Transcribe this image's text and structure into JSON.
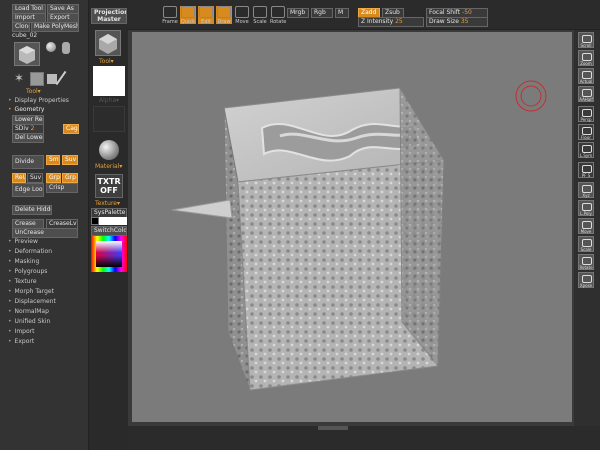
{
  "app": {
    "tool_buttons": [
      "Load Tool",
      "Save As",
      "Import",
      "Export",
      "Clone",
      "Make PolyMesh3D"
    ],
    "tool_name": "cube_02",
    "tool_label": "Tool▾",
    "sub_tools_label": "Geometry"
  },
  "left_panel": {
    "menu_top": [
      "Display Properties",
      "Geometry"
    ],
    "lower_res": "Lower Res",
    "sdiv": "SDiv",
    "sdiv_value": "2",
    "cage": "Cage",
    "del_lower": "Del Lower",
    "divide": "Divide",
    "smt": "Smt",
    "suv": "Suv",
    "reuv": "ReUV",
    "edge_loop": "Edge Loop",
    "grp_label": "Grp",
    "crisp": "Crisp",
    "delete_hidden": "Delete Hidden",
    "crease": "Crease",
    "crease_lvl": "CreaseLvl",
    "uncrease": "UnCrease",
    "menu_bottom": [
      "Preview",
      "Deformation",
      "Masking",
      "Polygroups",
      "Texture",
      "Morph Target",
      "Displacement",
      "NormalMap",
      "Unified Skin",
      "Import",
      "Export"
    ]
  },
  "middle_palette": {
    "projection_master": "Projection Master",
    "tool_label": "Tool▾",
    "alpha_label": "Alpha▾",
    "material_label": "Material▾",
    "txtr_off_line1": "TXTR",
    "txtr_off_line2": "OFF",
    "texture_label": "Texture▾",
    "syspalette": "SysPalette",
    "switchcolor": "SwitchColor"
  },
  "toolbar": {
    "buttons": [
      {
        "label": "Frame",
        "active": false
      },
      {
        "label": "Quick",
        "active": true
      },
      {
        "label": "Edit",
        "active": true
      },
      {
        "label": "Draw",
        "active": true
      },
      {
        "label": "Move",
        "active": false
      },
      {
        "label": "Scale",
        "active": false
      },
      {
        "label": "Rotate",
        "active": false
      }
    ],
    "mrgb": "Mrgb",
    "rgb": "Rgb",
    "m": "M",
    "zadd": "Zadd",
    "zsub": "Zsub",
    "z_intensity_label": "Z Intensity",
    "z_intensity_value": "25",
    "focal_shift_label": "Focal Shift",
    "focal_shift_value": "-50",
    "draw_size_label": "Draw Size",
    "draw_size_value": "35"
  },
  "right_tray": [
    {
      "label": "Scroll"
    },
    {
      "label": "Zoom"
    },
    {
      "label": "Actual"
    },
    {
      "label": "AAHalf"
    },
    {
      "label": "Persp"
    },
    {
      "label": "Floor"
    },
    {
      "label": "L.Sym"
    },
    {
      "label": "PF S"
    },
    {
      "label": "Xyz"
    },
    {
      "label": "L.Poly"
    },
    {
      "label": "Move"
    },
    {
      "label": "Scale"
    },
    {
      "label": "Rotate"
    },
    {
      "label": "Xpose"
    },
    {
      "label": "Snap"
    }
  ],
  "colors": {
    "accent": "#d98a1f",
    "canvas": "#7b7b7b",
    "panel": "#2f2f2f"
  }
}
